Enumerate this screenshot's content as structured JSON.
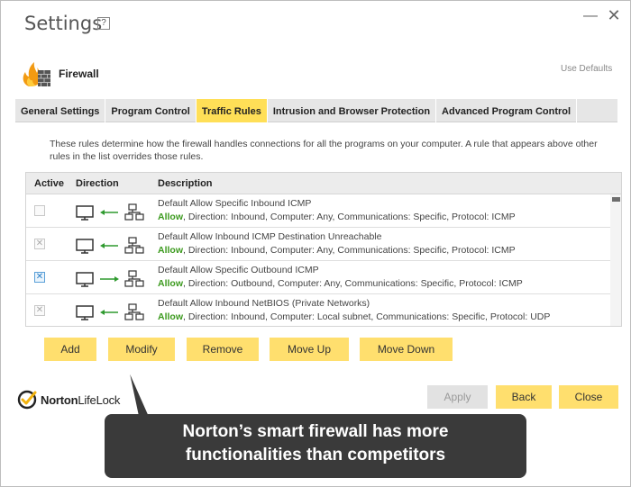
{
  "window": {
    "title": "Settings",
    "help_label": "?",
    "minimize_label": "—",
    "close_label": "✕"
  },
  "section": {
    "label": "Firewall",
    "use_defaults": "Use Defaults"
  },
  "tabs": [
    {
      "label": "General Settings",
      "active": false
    },
    {
      "label": "Program Control",
      "active": false
    },
    {
      "label": "Traffic Rules",
      "active": true
    },
    {
      "label": "Intrusion and Browser Protection",
      "active": false
    },
    {
      "label": "Advanced Program Control",
      "active": false
    }
  ],
  "intro": "These rules determine how the firewall handles connections for all the programs on your computer. A rule that appears above other rules in the list overrides those rules.",
  "table": {
    "headers": {
      "active": "Active",
      "direction": "Direction",
      "description": "Description"
    },
    "rows": [
      {
        "active": false,
        "checked_mark": "",
        "direction": "inbound",
        "name": "Default Allow Specific Inbound ICMP",
        "action": "Allow",
        "detail": ", Direction: Inbound, Computer: Any, Communications: Specific, Protocol: ICMP"
      },
      {
        "active": false,
        "checked_mark": "✕",
        "direction": "inbound",
        "name": "Default Allow Inbound ICMP Destination Unreachable",
        "action": "Allow",
        "detail": ", Direction: Inbound, Computer: Any, Communications: Specific, Protocol: ICMP"
      },
      {
        "active": true,
        "checked_mark": "✕",
        "direction": "outbound",
        "name": "Default Allow Specific Outbound ICMP",
        "action": "Allow",
        "detail": ", Direction: Outbound, Computer: Any, Communications: Specific, Protocol: ICMP"
      },
      {
        "active": false,
        "checked_mark": "✕",
        "direction": "inbound",
        "name": "Default Allow Inbound NetBIOS (Private Networks)",
        "action": "Allow",
        "detail": ", Direction: Inbound, Computer: Local subnet, Communications: Specific, Protocol: UDP"
      }
    ]
  },
  "actions": {
    "add": "Add",
    "modify": "Modify",
    "remove": "Remove",
    "move_up": "Move Up",
    "move_down": "Move Down"
  },
  "footer": {
    "apply": "Apply",
    "back": "Back",
    "close": "Close"
  },
  "logo": {
    "brand_a": "Norton",
    "brand_b": "LifeLock"
  },
  "callout": {
    "line1": "Norton’s smart firewall has more",
    "line2": "functionalities than competitors"
  },
  "colors": {
    "accent": "#ffdf57",
    "allow": "#3c9a1e",
    "callout_bg": "#3a3a3a"
  },
  "icons": [
    "firewall-icon",
    "computer-icon",
    "network-icon",
    "arrow-left-icon",
    "arrow-right-icon",
    "norton-check-icon",
    "help-icon",
    "minimize-icon",
    "close-icon"
  ]
}
